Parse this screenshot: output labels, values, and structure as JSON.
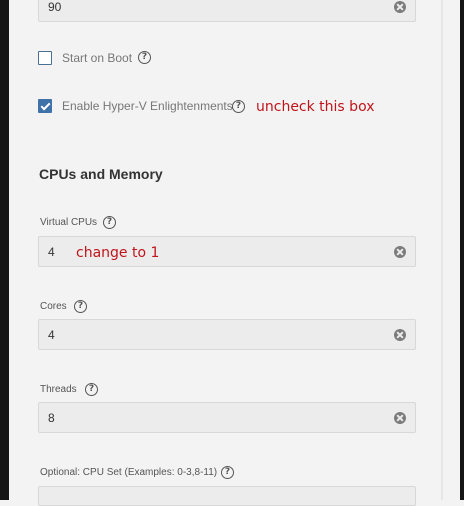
{
  "fields_top": {
    "timeout_value": "90"
  },
  "checkboxes": {
    "start_on_boot": {
      "label": "Start on Boot",
      "checked": false
    },
    "hyperv": {
      "label": "Enable Hyper-V Enlightenments",
      "checked": true
    }
  },
  "annotations": {
    "hyperv_note": "uncheck this box",
    "vcpu_note": "change to 1"
  },
  "section": {
    "title": "CPUs and Memory"
  },
  "fields": {
    "virtual_cpus": {
      "label": "Virtual CPUs",
      "value": "4"
    },
    "cores": {
      "label": "Cores",
      "value": "4"
    },
    "threads": {
      "label": "Threads",
      "value": "8"
    },
    "cpu_set": {
      "label": "Optional: CPU Set (Examples: 0-3,8-11)",
      "value": ""
    }
  },
  "colors": {
    "checkbox_checked": "#3f72a8",
    "annotation": "#c0141b",
    "background": "#f3f3f3"
  }
}
